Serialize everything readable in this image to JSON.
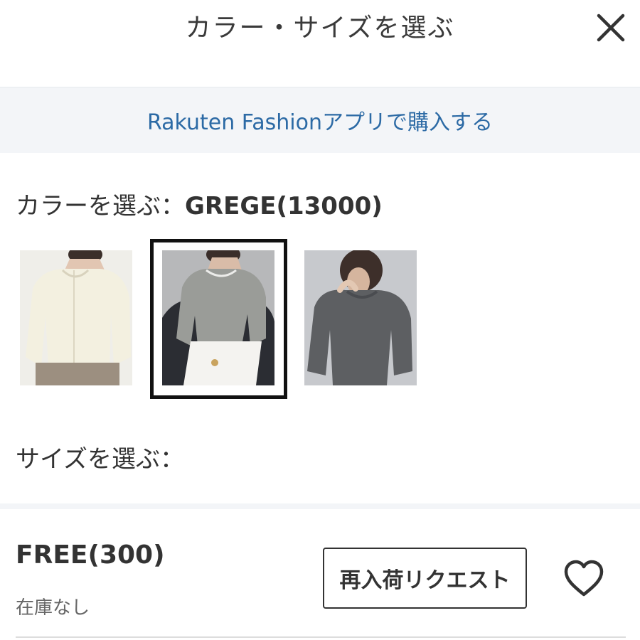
{
  "header": {
    "title": "カラー・サイズを選ぶ",
    "close_icon": "close-icon"
  },
  "app_banner": {
    "link_text": "Rakuten Fashionアプリで購入する",
    "link_color": "#2c6aa5",
    "background": "#f3f5f8"
  },
  "color_section": {
    "label": "カラーを選ぶ：",
    "selected_value": "GREGE(13000)",
    "swatches": [
      {
        "name": "ivory",
        "selected": false
      },
      {
        "name": "grege",
        "selected": true
      },
      {
        "name": "charcoal",
        "selected": false
      }
    ]
  },
  "size_section": {
    "label": "サイズを選ぶ：",
    "sizes": [
      {
        "name": "FREE(300)",
        "stock": "在庫なし",
        "restock_label": "再入荷リクエスト",
        "favorite_icon": "heart-icon"
      }
    ]
  }
}
